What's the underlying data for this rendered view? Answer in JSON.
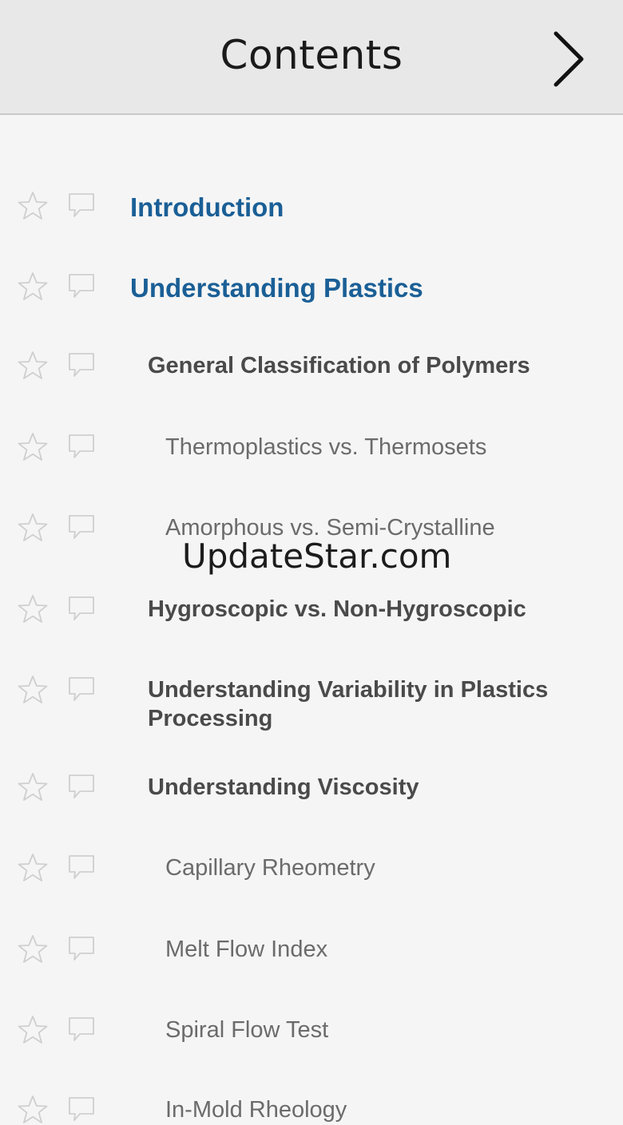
{
  "header": {
    "title": "Contents",
    "next_icon": "chevron-right-icon"
  },
  "toc": {
    "star_icon": "star-outline-icon",
    "note_icon": "speech-bubble-icon",
    "items": [
      {
        "label": "Introduction",
        "level": 1
      },
      {
        "label": "Understanding Plastics",
        "level": 1
      },
      {
        "label": "General Classification of Polymers",
        "level": 2
      },
      {
        "label": "Thermoplastics vs. Thermosets",
        "level": 3
      },
      {
        "label": "Amorphous vs. Semi-Crystalline",
        "level": 3
      },
      {
        "label": "Hygroscopic vs. Non-Hygroscopic",
        "level": 2
      },
      {
        "label": "Understanding Variability in Plastics Processing",
        "level": 2
      },
      {
        "label": "Understanding Viscosity",
        "level": 2
      },
      {
        "label": "Capillary Rheometry",
        "level": 3
      },
      {
        "label": "Melt Flow Index",
        "level": 3
      },
      {
        "label": "Spiral Flow Test",
        "level": 3
      },
      {
        "label": "In-Mold Rheology",
        "level": 3
      }
    ]
  },
  "watermark": "UpdateStar.com",
  "colors": {
    "heading_blue": "#1a5f96",
    "subheading_gray": "#4a4a4a",
    "item_gray": "#6b6b6b",
    "icon_gray": "#cfcfcf",
    "header_bg": "#e8e8e8",
    "page_bg": "#f5f5f5"
  }
}
